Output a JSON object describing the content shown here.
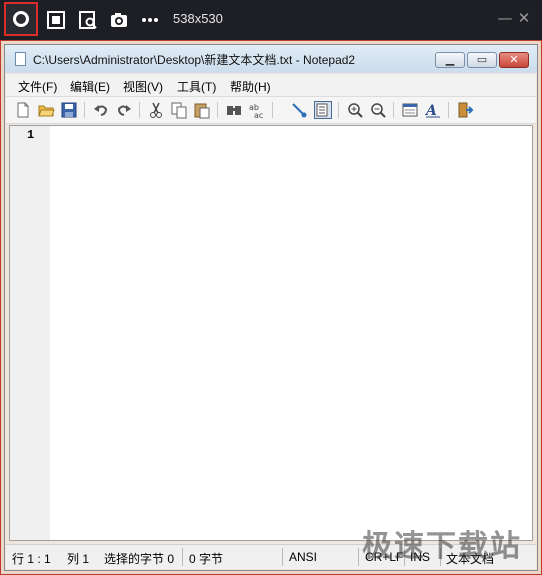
{
  "capture_bar": {
    "dimensions": "538x530",
    "icons": [
      "record-icon",
      "fullscreen-capture-icon",
      "window-capture-icon",
      "camera-icon",
      "more-icon",
      "minimize-icon",
      "close-icon"
    ]
  },
  "window": {
    "title": "C:\\Users\\Administrator\\Desktop\\新建文本文档.txt - Notepad2",
    "buttons": [
      "minimize",
      "maximize",
      "close"
    ]
  },
  "menu": [
    {
      "label": "文件(F)"
    },
    {
      "label": "编辑(E)"
    },
    {
      "label": "视图(V)"
    },
    {
      "label": "工具(T)"
    },
    {
      "label": "帮助(H)"
    }
  ],
  "toolbar": {
    "icons": [
      "new-icon",
      "open-icon",
      "save-icon",
      "undo-icon",
      "redo-icon",
      "cut-icon",
      "copy-icon",
      "paste-icon",
      "find-icon",
      "replace-icon",
      "word-wrap-icon",
      "view-whitespace-icon",
      "zoom-in-icon",
      "zoom-out-icon",
      "scheme-icon",
      "font-icon",
      "exit-icon"
    ],
    "active": "view-whitespace-icon"
  },
  "editor": {
    "line_number": "1",
    "content": ""
  },
  "status": {
    "position": "行 1 : 1",
    "column": "列 1",
    "selection": "选择的字节 0",
    "size": "0 字节",
    "encoding": "ANSI",
    "line_ending": "CR+LF",
    "mode": "INS",
    "doc_type": "文本文档"
  },
  "watermark": "极速下载站",
  "colors": {
    "capture_bar_bg": "#1e1f24",
    "record_border": "#e02b2b",
    "window_border": "#c0392b",
    "titlebar_top": "#e1ecf6",
    "close_button": "#c8473a"
  }
}
